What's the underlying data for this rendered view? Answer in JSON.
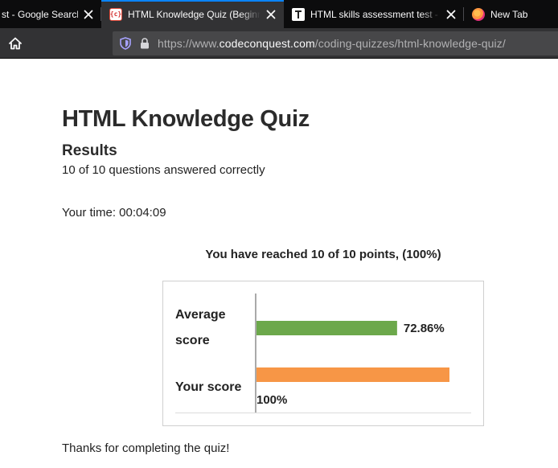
{
  "browser": {
    "tabs": [
      {
        "title": "st - Google Search",
        "active": false,
        "icon": "google-icon"
      },
      {
        "title": "HTML Knowledge Quiz (Beginn",
        "active": true,
        "icon": "codeconquest-icon"
      },
      {
        "title": "HTML skills assessment test - F",
        "active": false,
        "icon": "page-icon"
      },
      {
        "title": "New Tab",
        "active": false,
        "icon": "firefox-icon"
      }
    ],
    "url_prefix": "https://www.",
    "url_host": "codeconquest.com",
    "url_path": "/coding-quizzes/html-knowledge-quiz/"
  },
  "quiz": {
    "title": "HTML Knowledge Quiz",
    "results_heading": "Results",
    "answered_text": "10 of 10 questions answered correctly",
    "time_text": "Your time: 00:04:09",
    "points_text": "You have reached 10 of 10 points, (100%)",
    "thanks_text": "Thanks for completing the quiz!"
  },
  "chart_data": {
    "type": "bar",
    "orientation": "horizontal",
    "categories": [
      "Average score",
      "Your score"
    ],
    "values": [
      72.86,
      100
    ],
    "value_labels": [
      "72.86%",
      "100%"
    ],
    "colors": [
      "#6ca84b",
      "#f79646"
    ],
    "xlim": [
      0,
      100
    ],
    "grid": false
  },
  "colors": {
    "tab_accent": "#0a84ff",
    "toolbar_bg": "#323234",
    "average_bar": "#6ca84b",
    "your_bar": "#f79646"
  }
}
